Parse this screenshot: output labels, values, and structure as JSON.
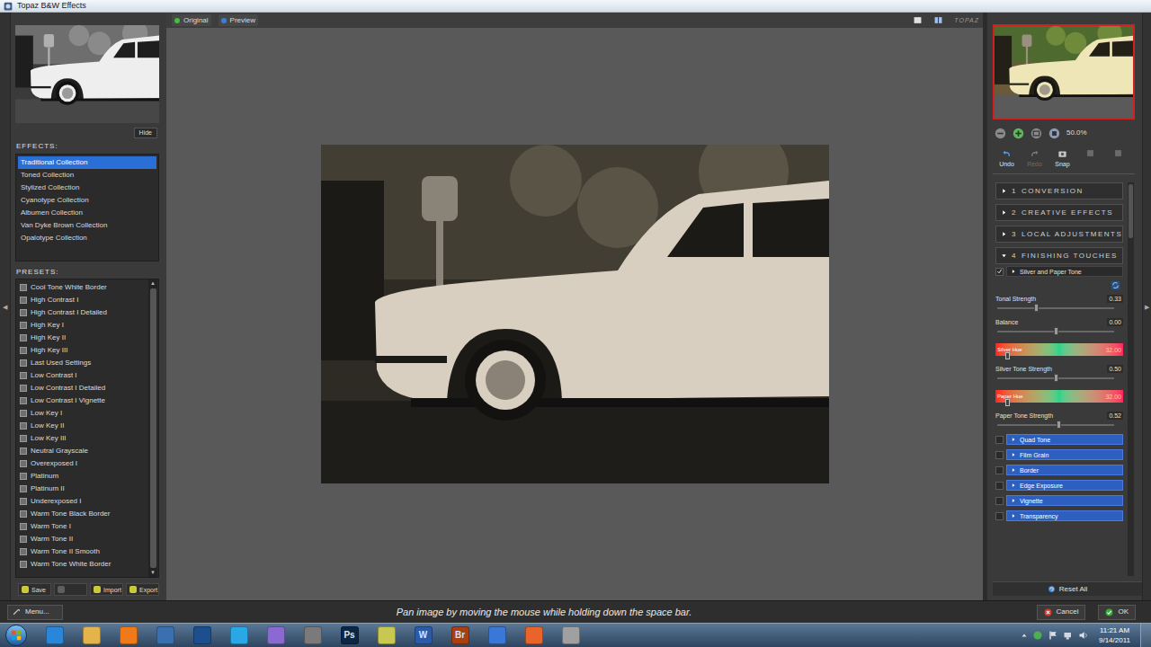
{
  "window": {
    "title": "Topaz B&W Effects"
  },
  "side_arrows": {
    "left": "◀",
    "right": "▶"
  },
  "left_panel": {
    "hide_button": "Hide",
    "effects_label": "EFFECTS:",
    "effects": [
      {
        "label": "Traditional Collection",
        "selected": true
      },
      {
        "label": "Toned Collection",
        "selected": false
      },
      {
        "label": "Stylized Collection",
        "selected": false
      },
      {
        "label": "Cyanotype Collection",
        "selected": false
      },
      {
        "label": "Albumen Collection",
        "selected": false
      },
      {
        "label": "Van Dyke Brown Collection",
        "selected": false
      },
      {
        "label": "Opalotype Collection",
        "selected": false
      }
    ],
    "presets_label": "PRESETS:",
    "presets": [
      {
        "label": "Cool Tone White Border",
        "selected": false
      },
      {
        "label": "High Contrast I",
        "selected": false
      },
      {
        "label": "High Contrast I Detailed",
        "selected": false
      },
      {
        "label": "High Key I",
        "selected": false
      },
      {
        "label": "High Key II",
        "selected": false
      },
      {
        "label": "High Key III",
        "selected": false
      },
      {
        "label": "Last Used Settings",
        "selected": false
      },
      {
        "label": "Low Contrast I",
        "selected": false
      },
      {
        "label": "Low Contrast I Detailed",
        "selected": false
      },
      {
        "label": "Low Contrast I Vignette",
        "selected": false
      },
      {
        "label": "Low Key I",
        "selected": false
      },
      {
        "label": "Low Key II",
        "selected": false
      },
      {
        "label": "Low Key III",
        "selected": false
      },
      {
        "label": "Neutral Grayscale",
        "selected": false
      },
      {
        "label": "Overexposed I",
        "selected": false
      },
      {
        "label": "Platinum",
        "selected": false
      },
      {
        "label": "Platinum II",
        "selected": false
      },
      {
        "label": "Underexposed I",
        "selected": false
      },
      {
        "label": "Warm Tone Black Border",
        "selected": false
      },
      {
        "label": "Warm Tone I",
        "selected": false
      },
      {
        "label": "Warm Tone II",
        "selected": false
      },
      {
        "label": "Warm Tone II Smooth",
        "selected": false
      },
      {
        "label": "Warm Tone White Border",
        "selected": false
      }
    ],
    "scrollbar": {
      "up": "▲",
      "down": "▼"
    },
    "buttons": [
      {
        "label": "Save",
        "disabled": false
      },
      {
        "disabled": true
      },
      {
        "label": "Import",
        "disabled": false
      },
      {
        "label": "Export",
        "disabled": false
      }
    ]
  },
  "view_tabs": [
    {
      "label": "Original",
      "color": "#3fbf3f"
    },
    {
      "label": "Preview",
      "color": "#3c7fd8"
    }
  ],
  "logo": "TOPAZ",
  "right_panel": {
    "zoom": "50.0%",
    "history": [
      {
        "label": "Undo",
        "disabled": false
      },
      {
        "label": "Redo",
        "disabled": true
      },
      {
        "label": "Snap",
        "disabled": false
      },
      {
        "disabled": true
      },
      {
        "disabled": true
      }
    ],
    "sections": [
      {
        "number": "1",
        "label": "CONVERSION",
        "expanded": false
      },
      {
        "number": "2",
        "label": "CREATIVE EFFECTS",
        "expanded": false
      },
      {
        "number": "3",
        "label": "LOCAL ADJUSTMENTS",
        "expanded": false
      },
      {
        "number": "4",
        "label": "FINISHING TOUCHES",
        "expanded": true
      }
    ],
    "tone": {
      "title": "Silver and Paper Tone",
      "checked": true,
      "expanded": false,
      "controls": [
        {
          "kind": "slider",
          "label": "Tonal Strength",
          "value": "0.33",
          "level": 0.33
        },
        {
          "kind": "slider",
          "label": "Balance",
          "value": "0.00",
          "level": 0.5
        },
        {
          "kind": "hue",
          "label": "Silver Hue",
          "value": "32.00",
          "level": 0.09
        },
        {
          "kind": "slider",
          "label": "Silver Tone Strength",
          "value": "0.50",
          "level": 0.5
        },
        {
          "kind": "hue",
          "label": "Paper Hue",
          "value": "32.00",
          "level": 0.09
        },
        {
          "kind": "slider",
          "label": "Paper Tone Strength",
          "value": "0.52",
          "level": 0.52
        }
      ]
    },
    "modules": [
      {
        "label": "Quad Tone",
        "checked": false
      },
      {
        "label": "Film Grain",
        "checked": false
      },
      {
        "label": "Border",
        "checked": false
      },
      {
        "label": "Edge Exposure",
        "checked": false
      },
      {
        "label": "Vignette",
        "checked": false
      },
      {
        "label": "Transparency",
        "checked": false
      }
    ],
    "reset": "Reset All"
  },
  "bottom_bar": {
    "menu": "Menu...",
    "hint": "Pan image by moving the mouse while holding down the space bar.",
    "buttons": [
      {
        "label": "Cancel",
        "kind": "cancel"
      },
      {
        "label": "OK",
        "kind": "ok"
      }
    ]
  },
  "taskbar": {
    "apps": [
      {
        "color": "#2a86d8"
      },
      {
        "color": "#e4b44a"
      },
      {
        "color": "#f07a1a"
      },
      {
        "color": "#3a70b0"
      },
      {
        "color": "#1d4f8f"
      },
      {
        "color": "#29a8e8"
      },
      {
        "color": "#8a6ad0"
      },
      {
        "color": "#7a7a7a"
      },
      {
        "label": "Ps",
        "color": "#0b2745"
      },
      {
        "color": "#c8c850"
      },
      {
        "label": "W",
        "color": "#2b5aa8"
      },
      {
        "label": "Br",
        "color": "#a8400f"
      },
      {
        "color": "#3a78d8"
      },
      {
        "color": "#e8642a"
      },
      {
        "color": "#a0a0a0"
      }
    ],
    "clock": {
      "time": "11:21 AM",
      "date": "9/14/2011"
    }
  }
}
